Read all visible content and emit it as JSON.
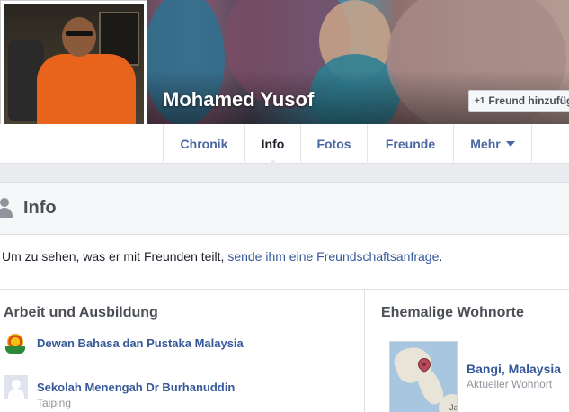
{
  "profile": {
    "name": "Mohamed Yusof",
    "add_friend_label": "Freund hinzufüg"
  },
  "tabs": [
    {
      "label": "Chronik",
      "active": false
    },
    {
      "label": "Info",
      "active": true
    },
    {
      "label": "Fotos",
      "active": false
    },
    {
      "label": "Freunde",
      "active": false
    },
    {
      "label": "Mehr",
      "active": false
    }
  ],
  "info": {
    "title": "Info",
    "notice_text": "Um zu sehen, was er mit Freunden teilt, ",
    "notice_link": "sende ihm eine Freundschaftsanfrage",
    "notice_end": "."
  },
  "work_education": {
    "title": "Arbeit und Ausbildung",
    "entries": [
      {
        "name": "Dewan Bahasa dan Pustaka Malaysia",
        "sub": "",
        "icon": "crest-icon"
      },
      {
        "name": "Sekolah Menengah Dr Burhanuddin",
        "sub": "Taiping",
        "icon": "school-placeholder-icon"
      }
    ]
  },
  "places": {
    "title": "Ehemalige Wohnorte",
    "entries": [
      {
        "name": "Bangi, Malaysia",
        "sub": "Aktueller Wohnort",
        "icon": "map-thumbnail"
      }
    ],
    "map_label": "Ja"
  },
  "colors": {
    "link": "#365899",
    "tab_link": "#4b67a1",
    "background": "#e9ebee"
  }
}
